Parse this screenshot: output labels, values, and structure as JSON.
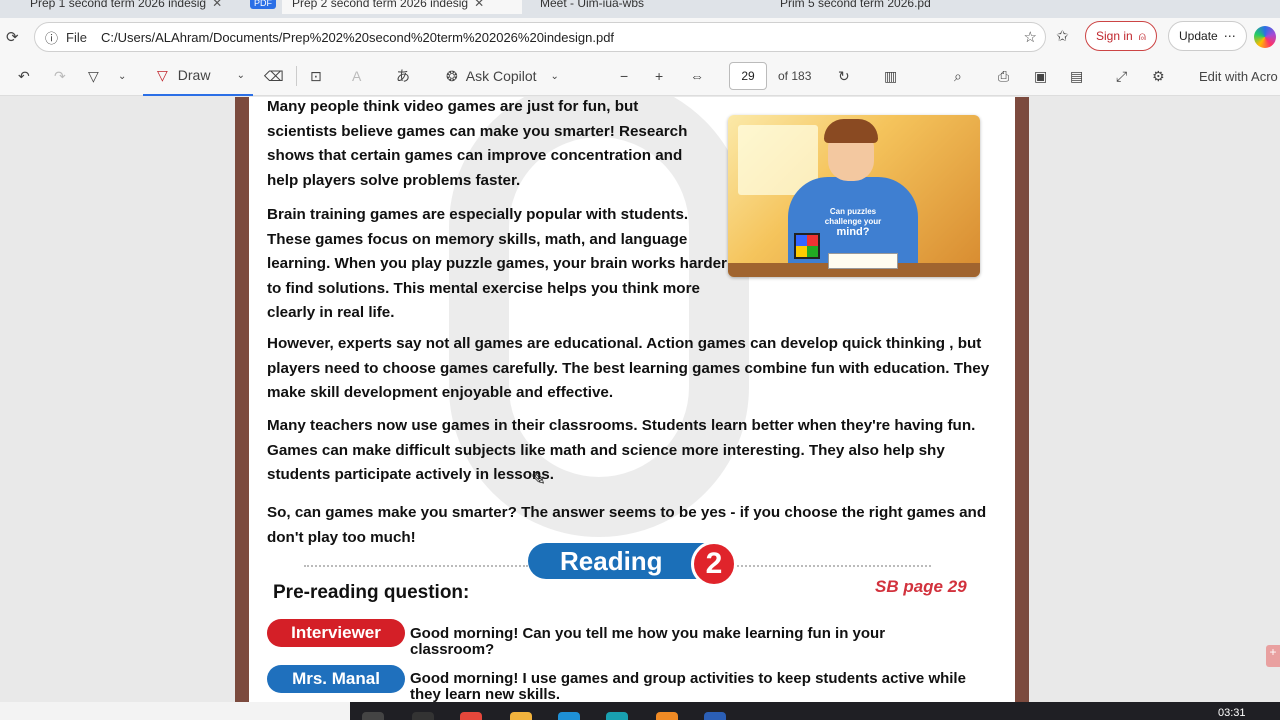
{
  "tabs": [
    {
      "label": "Prep 1 second term 2026 indesig",
      "active": false
    },
    {
      "label": "PDF",
      "active": false
    },
    {
      "label": "Prep 2 second term 2026 indesig",
      "active": true
    },
    {
      "label": "Meet - Uim-iua-wbs",
      "active": false
    },
    {
      "label": "Prim 5 second term 2026.pd",
      "active": false
    }
  ],
  "address": {
    "scheme_label": "File",
    "path": "C:/Users/ALAhram/Documents/Prep%202%20second%20term%202026%20indesign.pdf"
  },
  "browser": {
    "signin_label": "Sign in",
    "update_label": "Update"
  },
  "toolbar": {
    "draw_label": "Draw",
    "ask_copilot_label": "Ask Copilot",
    "page_current": "29",
    "page_total": "of 183",
    "edit_label": "Edit with Acro"
  },
  "document": {
    "para1": "Many people think video games are just for fun, but scientists believe games can make you smarter! Research shows that certain games can improve concentration and help players solve problems faster.",
    "para2": "Brain training games are especially popular with students. These games focus on memory skills, math, and language learning. When you play puzzle games, your brain works harder to find solutions. This mental exercise helps you think more clearly in real life.",
    "para3": "However, experts say not all games are educational. Action games can develop quick thinking , but players need to choose games carefully. The best learning games combine fun with education. They make skill development enjoyable and effective.",
    "para4": "Many teachers now use games in their classrooms. Students learn better when they're having fun. Games can make difficult subjects like math and science more interesting. They also help shy students participate actively in lessons.",
    "para5": "So, can games make you smarter? The answer seems to be yes - if you choose the right games and don't play too much!",
    "illustration": {
      "hoodie_line1": "Can puzzles",
      "hoodie_line2": "challenge your",
      "hoodie_line3": "mind?"
    },
    "reading_label": "Reading",
    "reading_number": "2",
    "prereading_label": "Pre-reading question:",
    "sb_page": "SB page 29",
    "dialog": [
      {
        "speaker": "Interviewer",
        "color": "red",
        "text": "Good morning! Can you tell me how you make learning fun in your classroom?"
      },
      {
        "speaker": "Mrs. Manal",
        "color": "blue",
        "text": "Good morning! I use games and group activities to keep students active while they learn new skills."
      }
    ]
  },
  "taskbar": {
    "clock": "03:31"
  }
}
